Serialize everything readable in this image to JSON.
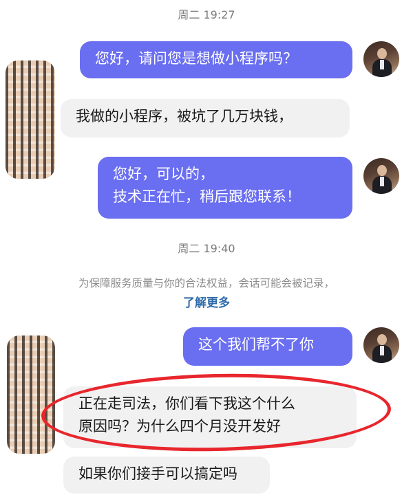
{
  "timestamps": [
    "周二 19:27",
    "周二 19:40"
  ],
  "messages": [
    {
      "side": "out",
      "lines": [
        "您好，请问您是想做小程序吗？"
      ]
    },
    {
      "side": "in",
      "lines": [
        "我做的小程序，被坑了几万块钱，"
      ]
    },
    {
      "side": "out",
      "lines": [
        "您好，可以的，",
        "技术正在忙，稍后跟您联系！"
      ]
    },
    {
      "side": "out",
      "lines": [
        "这个我们帮不了你"
      ]
    },
    {
      "side": "in",
      "lines": [
        "正在走司法，你们看下我这个什么",
        "原因吗？为什么四个月没开发好"
      ]
    },
    {
      "side": "in",
      "lines": [
        "如果你们接手可以搞定吗"
      ]
    }
  ],
  "notice": {
    "text": "为保障服务质量与你的合法权益，会话可能会被记录，",
    "link": "了解更多"
  },
  "colors": {
    "outgoing_bubble": "#6a6ef0",
    "incoming_bubble": "#f1f1f1",
    "annotation_circle": "#e8262d",
    "link": "#2d6ba8"
  }
}
